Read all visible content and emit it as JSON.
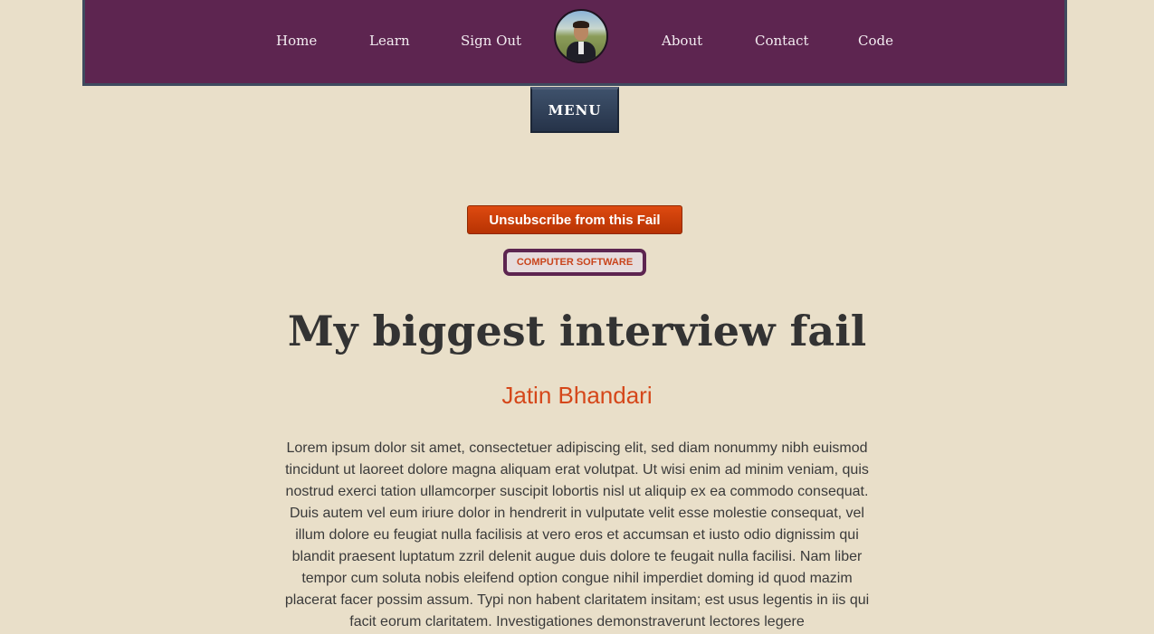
{
  "nav": {
    "home": "Home",
    "learn": "Learn",
    "sign_out": "Sign Out",
    "about": "About",
    "contact": "Contact",
    "code": "Code"
  },
  "menu_label": "MENU",
  "unsubscribe_label": "Unsubscribe from this Fail",
  "category_tag": "COMPUTER SOFTWARE",
  "post": {
    "title": "My biggest interview fail",
    "author": "Jatin Bhandari",
    "body": "Lorem ipsum dolor sit amet, consectetuer adipiscing elit, sed diam nonummy nibh euismod tincidunt ut laoreet dolore magna aliquam erat volutpat. Ut wisi enim ad minim veniam, quis nostrud exerci tation ullamcorper suscipit lobortis nisl ut aliquip ex ea commodo consequat. Duis autem vel eum iriure dolor in hendrerit in vulputate velit esse molestie consequat, vel illum dolore eu feugiat nulla facilisis at vero eros et accumsan et iusto odio dignissim qui blandit praesent luptatum zzril delenit augue duis dolore te feugait nulla facilisi. Nam liber tempor cum soluta nobis eleifend option congue nihil imperdiet doming id quod mazim placerat facer possim assum. Typi non habent claritatem insitam; est usus legentis in iis qui facit eorum claritatem. Investigationes demonstraverunt lectores legere"
  },
  "colors": {
    "nav_background": "#5d2550",
    "page_background": "#e9dfc9",
    "accent_orange": "#d5471a",
    "menu_button": "#2f3d55"
  }
}
